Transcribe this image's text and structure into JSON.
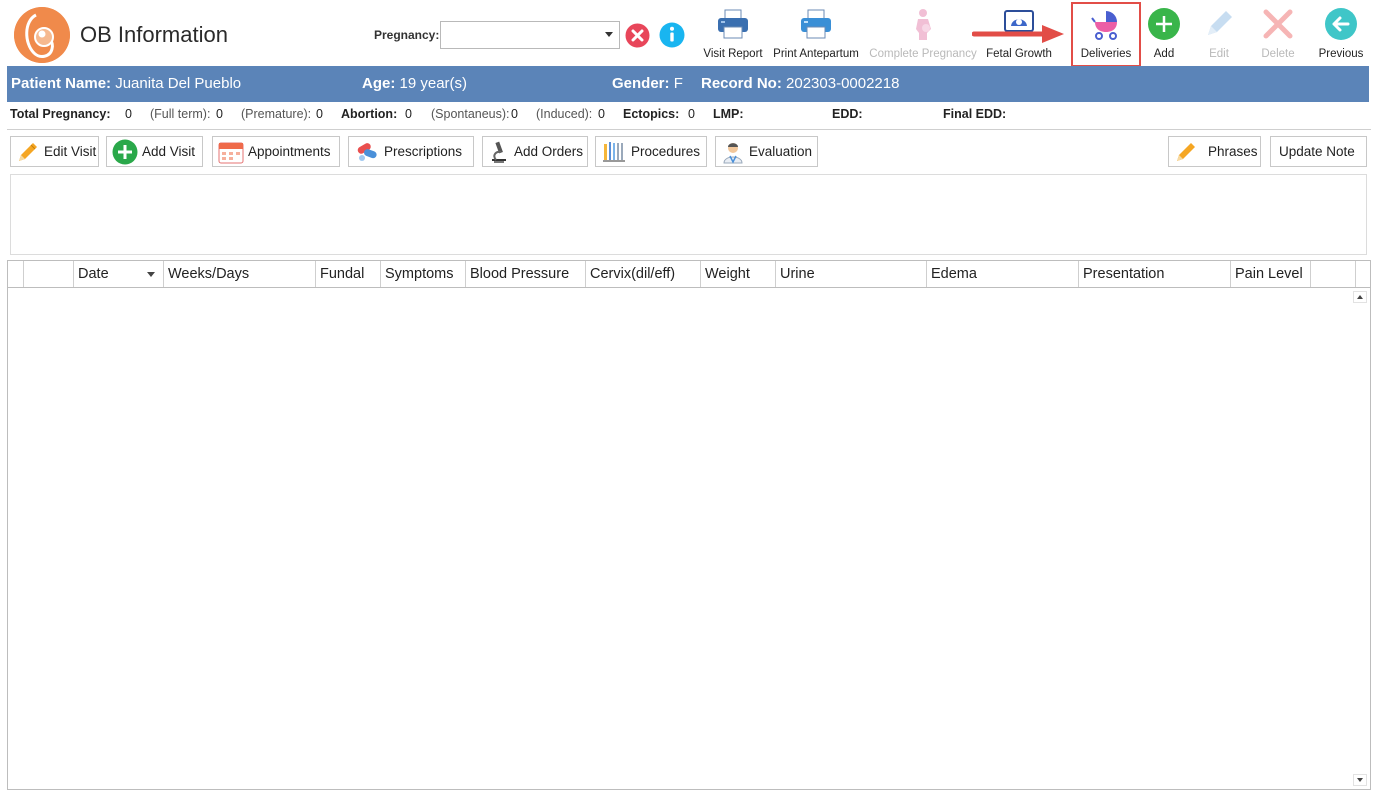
{
  "header": {
    "title": "OB Information",
    "pregnancy_label": "Pregnancy:",
    "pregnancy_value": ""
  },
  "toolbar": {
    "visit_report": "Visit Report",
    "print_antepartum": "Print Antepartum",
    "complete_pregnancy": "Complete Pregnancy",
    "fetal_growth": "Fetal Growth",
    "deliveries": "Deliveries",
    "add": "Add",
    "edit": "Edit",
    "delete": "Delete",
    "previous": "Previous"
  },
  "patient": {
    "name_label": "Patient Name:",
    "name": "Juanita Del Pueblo",
    "age_label": "Age:",
    "age": "19 year(s)",
    "gender_label": "Gender:",
    "gender": "F",
    "record_label": "Record No:",
    "record": "202303-0002218"
  },
  "stats": {
    "total_pregnancy_label": "Total Pregnancy:",
    "total_pregnancy": "0",
    "full_term_label": "(Full term):",
    "full_term": "0",
    "premature_label": "(Premature):",
    "premature": "0",
    "abortion_label": "Abortion:",
    "abortion": "0",
    "spontaneus_label": "(Spontaneus):",
    "spontaneus": "0",
    "induced_label": "(Induced):",
    "induced": "0",
    "ectopics_label": "Ectopics:",
    "ectopics": "0",
    "lmp_label": "LMP:",
    "edd_label": "EDD:",
    "final_edd_label": "Final EDD:"
  },
  "actions": {
    "edit_visit": "Edit Visit",
    "add_visit": "Add Visit",
    "appointments": "Appointments",
    "prescriptions": "Prescriptions",
    "add_orders": "Add Orders",
    "procedures": "Procedures",
    "evaluation": "Evaluation",
    "phrases": "Phrases",
    "update_note": "Update Note"
  },
  "grid": {
    "columns": [
      "Date",
      "Weeks/Days",
      "Fundal",
      "Symptoms",
      "Blood Pressure",
      "Cervix(dil/eff)",
      "Weight",
      "Urine",
      "Edema",
      "Presentation",
      "Pain Level"
    ]
  },
  "colors": {
    "patient_bar": "#5b84b8",
    "highlight": "#e24d47",
    "logo": "#f08a4b"
  }
}
